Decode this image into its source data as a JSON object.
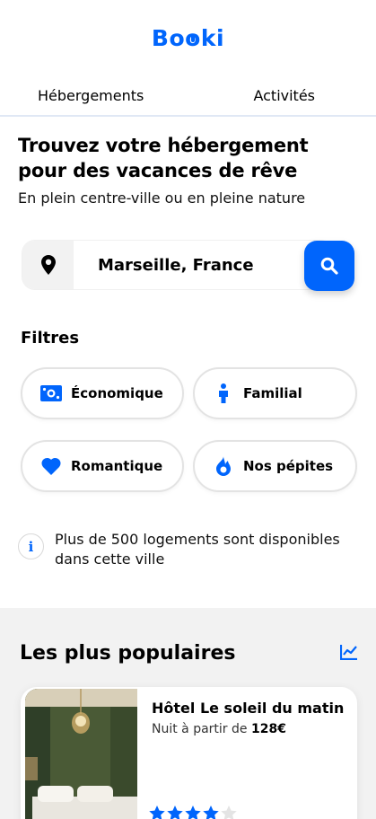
{
  "header": {
    "logo_a": "B",
    "logo_b": "o",
    "logo_c": "o",
    "logo_d": "ki"
  },
  "tabs": [
    {
      "label": "Hébergements"
    },
    {
      "label": "Activités"
    }
  ],
  "hero": {
    "title": "Trouvez votre hébergement pour des vacances de rêve",
    "subtitle": "En plein centre-ville ou en pleine nature"
  },
  "search": {
    "value": "Marseille, France",
    "pin_icon": "location-pin-icon",
    "button_icon": "search-icon"
  },
  "filters": {
    "title": "Filtres",
    "items": [
      {
        "label": "Économique",
        "icon": "money-bill-icon"
      },
      {
        "label": "Familial",
        "icon": "person-icon"
      },
      {
        "label": "Romantique",
        "icon": "heart-icon"
      },
      {
        "label": "Nos pépites",
        "icon": "flame-icon"
      }
    ]
  },
  "info": {
    "icon": "info-icon",
    "glyph": "i",
    "text": "Plus de 500 logements sont disponibles dans cette ville"
  },
  "popular": {
    "title": "Les plus populaires",
    "icon": "trend-chart-icon",
    "cards": [
      {
        "name": "Hôtel Le soleil du matin",
        "price_prefix": "Nuit à partir de ",
        "price": "128€",
        "rating": 4,
        "max_rating": 5
      }
    ]
  },
  "colors": {
    "accent": "#0065fc",
    "section_bg": "#f2f2f2"
  }
}
